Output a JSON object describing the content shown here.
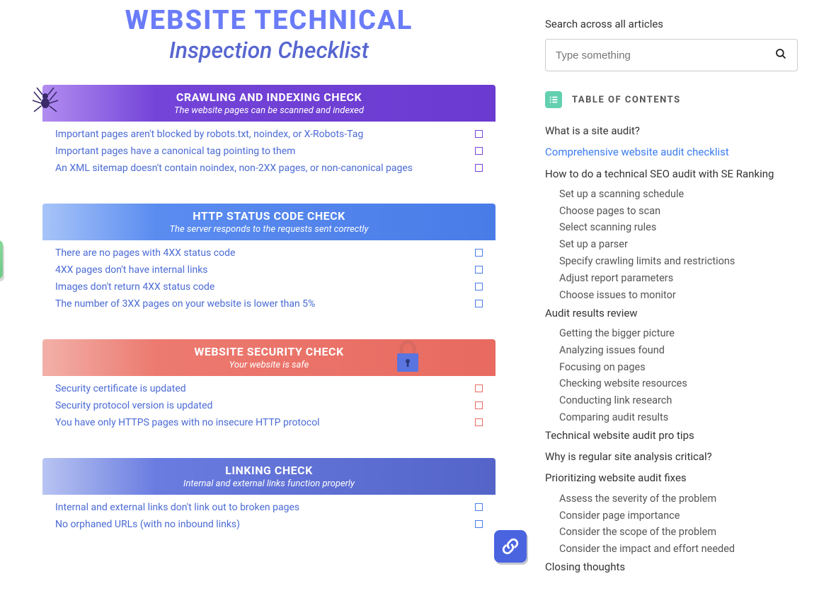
{
  "page": {
    "title": "WEBSITE TECHNICAL",
    "subtitle": "Inspection Checklist"
  },
  "sections": [
    {
      "id": "crawl",
      "title": "CRAWLING AND INDEXING CHECK",
      "sub": "The website pages can be scanned and indexed",
      "color": "purple",
      "items": [
        "Important pages aren't blocked by robots.txt, noindex, or X-Robots-Tag",
        "Important pages have a canonical tag pointing to them",
        "An XML sitemap doesn't contain noindex, non-2XX pages, or non-canonical pages"
      ]
    },
    {
      "id": "http",
      "title": "HTTP STATUS CODE CHECK",
      "sub": "The server responds to the requests sent correctly",
      "color": "blue",
      "items": [
        "There are no pages with 4XX status code",
        "4XX pages don't have internal links",
        "Images don't return 4XX status code",
        "The number of 3XX pages on your website is lower than 5%"
      ]
    },
    {
      "id": "security",
      "title": "WEBSITE SECURITY CHECK",
      "sub": "Your website is safe",
      "color": "red",
      "items": [
        "Security certificate is updated",
        "Security protocol version is updated",
        "You have only HTTPS pages with no insecure HTTP protocol"
      ]
    },
    {
      "id": "linking",
      "title": "LINKING CHECK",
      "sub": "Internal and external links function properly",
      "color": "blue2",
      "items": [
        "Internal and external links don't link out to broken pages",
        "No orphaned URLs (with no inbound links)"
      ]
    }
  ],
  "sidebar": {
    "search_label": "Search across all articles",
    "search_placeholder": "Type something",
    "toc_title": "TABLE OF CONTENTS",
    "toc": [
      {
        "label": "What is a site audit?",
        "level": 1
      },
      {
        "label": "Comprehensive website audit checklist",
        "level": 1,
        "active": true
      },
      {
        "label": "How to do a technical SEO audit with SE Ranking",
        "level": 1
      },
      {
        "label": "Set up a scanning schedule",
        "level": 2
      },
      {
        "label": "Choose pages to scan",
        "level": 2
      },
      {
        "label": "Select scanning rules",
        "level": 2
      },
      {
        "label": "Set up a parser",
        "level": 2
      },
      {
        "label": "Specify crawling limits and restrictions",
        "level": 2
      },
      {
        "label": "Adjust report parameters",
        "level": 2
      },
      {
        "label": "Choose issues to monitor",
        "level": 2
      },
      {
        "label": "Audit results review",
        "level": 1
      },
      {
        "label": "Getting the bigger picture",
        "level": 2
      },
      {
        "label": "Analyzing issues found",
        "level": 2
      },
      {
        "label": "Focusing on pages",
        "level": 2
      },
      {
        "label": "Checking website resources",
        "level": 2
      },
      {
        "label": "Conducting link research",
        "level": 2
      },
      {
        "label": "Comparing audit results",
        "level": 2
      },
      {
        "label": "Technical website audit pro tips",
        "level": 1
      },
      {
        "label": "Why is regular site analysis critical?",
        "level": 1
      },
      {
        "label": "Prioritizing website audit fixes",
        "level": 1
      },
      {
        "label": "Assess the severity of the problem",
        "level": 2
      },
      {
        "label": "Consider page importance",
        "level": 2
      },
      {
        "label": "Consider the scope of the problem",
        "level": 2
      },
      {
        "label": "Consider the impact and effort needed",
        "level": 2
      },
      {
        "label": "Closing thoughts",
        "level": 1
      }
    ]
  }
}
